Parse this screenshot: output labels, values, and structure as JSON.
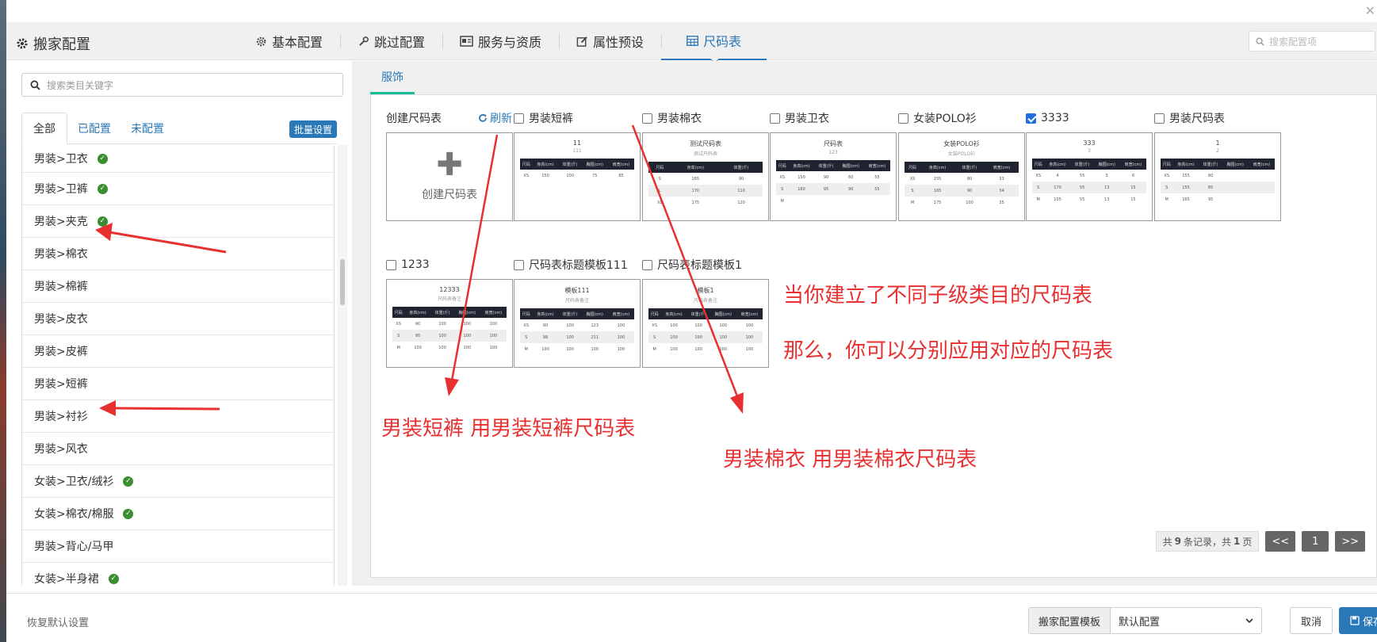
{
  "header": {
    "brand": "搬家配置",
    "tabs": [
      {
        "label": "基本配置",
        "icon": "gear-icon"
      },
      {
        "label": "跳过配置",
        "icon": "wrench-icon"
      },
      {
        "label": "服务与资质",
        "icon": "id-card-icon"
      },
      {
        "label": "属性预设",
        "icon": "edit-icon"
      },
      {
        "label": "尺码表",
        "icon": "table-icon",
        "active": true
      }
    ],
    "search_placeholder": "搜索配置项"
  },
  "left": {
    "search_placeholder": "搜索类目关键字",
    "tabs": [
      "全部",
      "已配置",
      "未配置"
    ],
    "batch_label": "批量设置",
    "categories": [
      {
        "label": "男装>卫衣",
        "configured": true
      },
      {
        "label": "男装>卫裤",
        "configured": true
      },
      {
        "label": "男装>夹克",
        "configured": true
      },
      {
        "label": "男装>棉衣",
        "configured": false
      },
      {
        "label": "男装>棉裤",
        "configured": false
      },
      {
        "label": "男装>皮衣",
        "configured": false
      },
      {
        "label": "男装>皮裤",
        "configured": false
      },
      {
        "label": "男装>短裤",
        "configured": false
      },
      {
        "label": "男装>衬衫",
        "configured": false
      },
      {
        "label": "男装>风衣",
        "configured": false
      },
      {
        "label": "女装>卫衣/绒衫",
        "configured": true
      },
      {
        "label": "女装>棉衣/棉服",
        "configured": true
      },
      {
        "label": "男装>背心/马甲",
        "configured": false
      },
      {
        "label": "女装>半身裙",
        "configured": true
      }
    ]
  },
  "right": {
    "tab": "服饰",
    "create_label": "创建尺码表",
    "refresh_label": "刷新",
    "create_box_text": "创建尺码表",
    "cards": [
      {
        "label": "男装短裤",
        "checked": false,
        "title": "11",
        "sub": "111",
        "cols": [
          "尺码",
          "身高(cm)",
          "体重(斤)",
          "胸围(cm)",
          "肩宽(cm)"
        ],
        "rows": [
          [
            "XS",
            "150",
            "100",
            "75",
            "85"
          ]
        ]
      },
      {
        "label": "男装棉衣",
        "checked": false,
        "title": "测试尺码表",
        "sub": "测试尺码表",
        "cols": [
          "尺码",
          "身高(cm)",
          "体重(斤)"
        ],
        "rows": [
          [
            "S",
            "165",
            "90"
          ],
          [
            "L",
            "170",
            "110"
          ],
          [
            "XL",
            "175",
            "120"
          ]
        ]
      },
      {
        "label": "男装卫衣",
        "checked": false,
        "title": "尺码表",
        "sub": "123",
        "cols": [
          "尺码",
          "身高(cm)",
          "体重(斤)",
          "胸围(cm)",
          "肩宽(cm)"
        ],
        "rows": [
          [
            "XS",
            "150",
            "90",
            "60",
            "55"
          ],
          [
            "S",
            "160",
            "95",
            "90",
            "55"
          ],
          [
            "M",
            "",
            "",
            "",
            ""
          ]
        ]
      },
      {
        "label": "女装POLO衫",
        "checked": false,
        "title": "女装POLO衫",
        "sub": "女装POLO衫",
        "cols": [
          "尺码",
          "身高(cm)",
          "体重(斤)",
          "肩宽(cm)"
        ],
        "rows": [
          [
            "XS",
            "155",
            "80",
            "33"
          ],
          [
            "S",
            "165",
            "90",
            "34"
          ],
          [
            "M",
            "175",
            "100",
            "35"
          ]
        ]
      },
      {
        "label": "3333",
        "checked": true,
        "title": "333",
        "sub": "3",
        "cols": [
          "尺码",
          "身高(cm)",
          "体重(斤)",
          "胸围(cm)",
          "肩宽(cm)"
        ],
        "rows": [
          [
            "XS",
            "4",
            "55",
            "5",
            "6"
          ],
          [
            "S",
            "170",
            "55",
            "13",
            "15"
          ],
          [
            "M",
            "105",
            "55",
            "13",
            "15"
          ]
        ]
      },
      {
        "label": "男装尺码表",
        "checked": false,
        "title": "1",
        "sub": "2",
        "cols": [
          "尺码",
          "身高(cm)",
          "体重(斤)",
          "胸围(cm)",
          "肩宽(cm)"
        ],
        "rows": [
          [
            "XS",
            "155",
            "80",
            "",
            ""
          ],
          [
            "S",
            "155",
            "85",
            "",
            ""
          ],
          [
            "M",
            "165",
            "95",
            "",
            ""
          ]
        ]
      },
      {
        "label": "1233",
        "checked": false,
        "title": "12333",
        "sub": "尺码表备注",
        "cols": [
          "尺码",
          "身高(cm)",
          "体重(斤)",
          "胸围(cm)",
          "肩宽(cm)"
        ],
        "rows": [
          [
            "XS",
            "90",
            "100",
            "100",
            "100"
          ],
          [
            "S",
            "95",
            "100",
            "100",
            "100"
          ],
          [
            "M",
            "100",
            "100",
            "100",
            "100"
          ]
        ]
      },
      {
        "label": "尺码表标题模板111",
        "checked": false,
        "title": "模板111",
        "sub": "尺码表备注",
        "cols": [
          "尺码",
          "身高(cm)",
          "体重(斤)",
          "胸围(cm)",
          "肩宽(cm)"
        ],
        "rows": [
          [
            "XS",
            "90",
            "100",
            "123",
            "100"
          ],
          [
            "S",
            "98",
            "100",
            "211",
            "100"
          ],
          [
            "M",
            "100",
            "100",
            "100",
            "100"
          ]
        ]
      },
      {
        "label": "尺码表标题模板1",
        "checked": false,
        "title": "模板1",
        "sub": "尺码表备注",
        "cols": [
          "尺码",
          "身高(cm)",
          "体重(斤)",
          "胸围(cm)",
          "肩宽(cm)"
        ],
        "rows": [
          [
            "XS",
            "100",
            "100",
            "100",
            "100"
          ],
          [
            "S",
            "100",
            "100",
            "100",
            "100"
          ],
          [
            "M",
            "100",
            "100",
            "100",
            "100"
          ]
        ]
      }
    ],
    "pager": {
      "prefix": "共",
      "records": "9",
      "middle": "条记录，共",
      "pages": "1",
      "suffix": "页",
      "prev": "<<",
      "current": "1",
      "next": ">>"
    }
  },
  "annotations": {
    "line1": "当你建立了不同子级类目的尺码表",
    "line2": "那么，你可以分别应用对应的尺码表",
    "shorts": "男装短裤 用男装短裤尺码表",
    "cotton": "男装棉衣 用男装棉衣尺码表"
  },
  "footer": {
    "reset": "恢复默认设置",
    "template_label": "搬家配置模板",
    "template_value": "默认配置",
    "cancel": "取消",
    "save": "保存"
  },
  "colors": {
    "accent": "#2b78b8",
    "annotation": "#e83030",
    "configured": "#3b8e2f"
  }
}
